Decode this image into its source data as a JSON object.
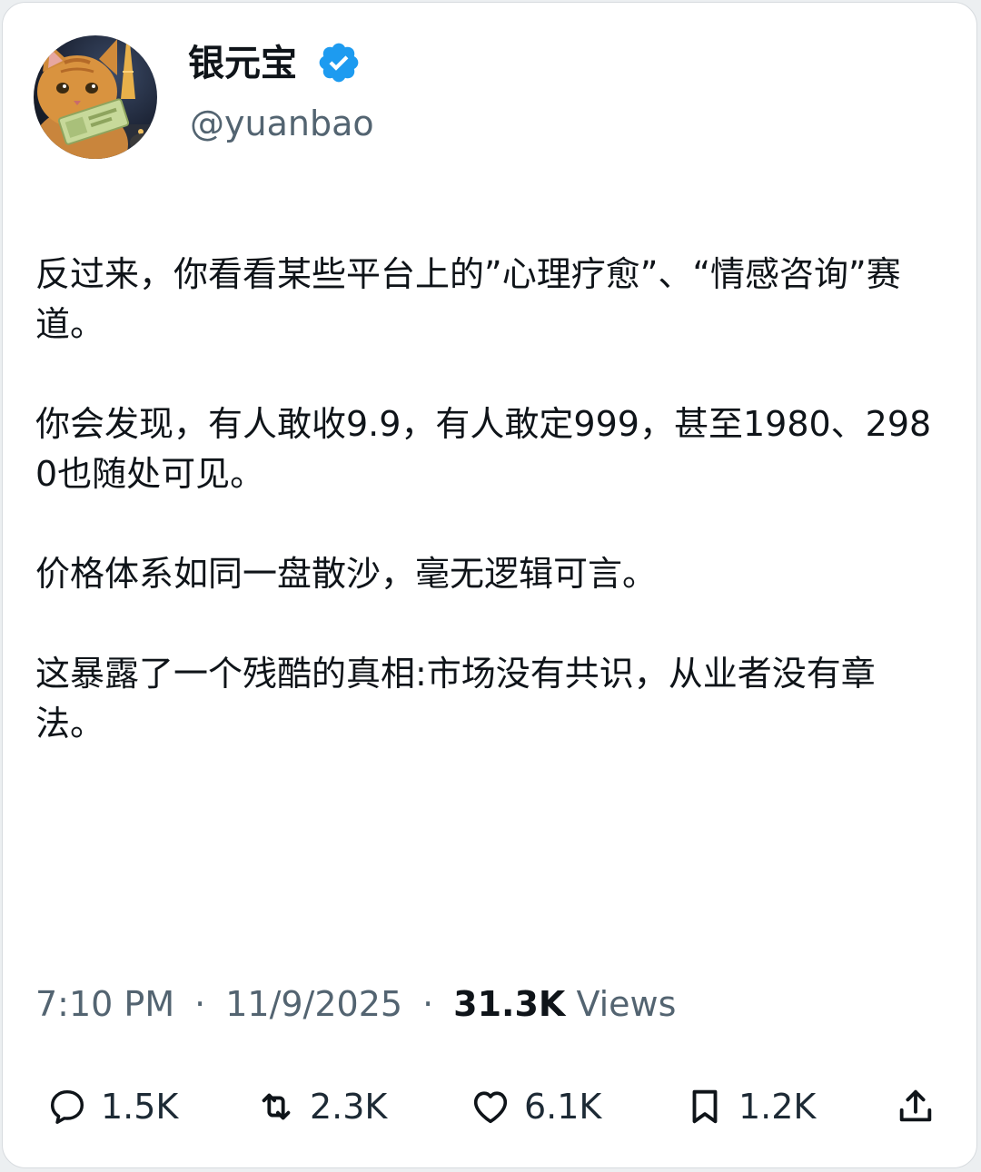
{
  "author": {
    "display_name": "银元宝",
    "handle": "@yuanbao",
    "verified": true,
    "avatar": "cat-avatar"
  },
  "tweet": {
    "paragraphs": [
      "反过来，你看看某些平台上的”心理疗愈”、“情感咨询”赛道。",
      "你会发现，有人敢收9.9，有人敢定999，甚至1980、2980也随处可见。",
      "价格体系如同一盘散沙，毫无逻辑可言。",
      "这暴露了一个残酷的真相:市场没有共识，从业者没有章法。"
    ]
  },
  "meta": {
    "time": "7:10 PM",
    "separator": "·",
    "date": "11/9/2025",
    "views_count": "31.3K",
    "views_label": "Views"
  },
  "actions": {
    "reply": {
      "icon": "reply-icon",
      "count": "1.5K"
    },
    "retweet": {
      "icon": "retweet-icon",
      "count": "2.3K"
    },
    "like": {
      "icon": "heart-icon",
      "count": "6.1K"
    },
    "bookmark": {
      "icon": "bookmark-icon",
      "count": "1.2K"
    },
    "share": {
      "icon": "share-icon"
    }
  },
  "colors": {
    "verified_blue": "#1d9bf0",
    "secondary_text": "#536471",
    "primary_text": "#0f1419"
  }
}
